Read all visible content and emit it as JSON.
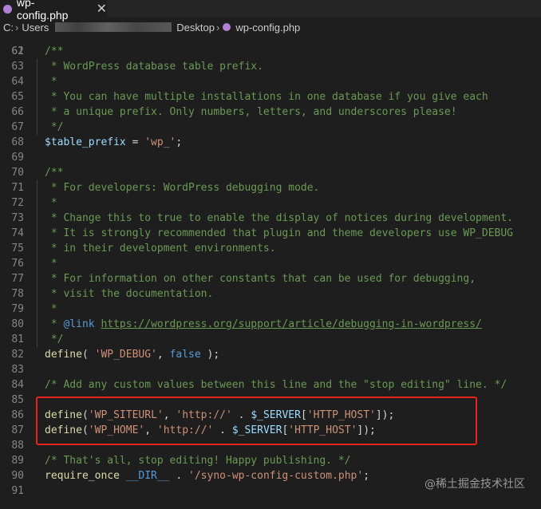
{
  "tab": {
    "filename": "wp-config.php",
    "close_glyph": "✕",
    "icon": "php-elephant-icon"
  },
  "breadcrumb": {
    "drive": "C:",
    "users": "Users",
    "desktop": "Desktop",
    "file": "wp-config.php",
    "sep": "›"
  },
  "editor": {
    "partial_top_line": "61",
    "lines": [
      {
        "n": "62",
        "tokens": [
          [
            "c",
            "/**"
          ]
        ]
      },
      {
        "n": "63",
        "tokens": [
          [
            "c",
            " * WordPress database table prefix."
          ]
        ]
      },
      {
        "n": "64",
        "tokens": [
          [
            "c",
            " *"
          ]
        ]
      },
      {
        "n": "65",
        "tokens": [
          [
            "c",
            " * You can have multiple installations in one database if you give each"
          ]
        ]
      },
      {
        "n": "66",
        "tokens": [
          [
            "c",
            " * a unique prefix. Only numbers, letters, and underscores please!"
          ]
        ]
      },
      {
        "n": "67",
        "tokens": [
          [
            "c",
            " */"
          ]
        ]
      },
      {
        "n": "68",
        "tokens": [
          [
            "v",
            "$table_prefix"
          ],
          [
            "p",
            " = "
          ],
          [
            "s",
            "'wp_'"
          ],
          [
            "p",
            ";"
          ]
        ]
      },
      {
        "n": "69",
        "tokens": []
      },
      {
        "n": "70",
        "tokens": [
          [
            "c",
            "/**"
          ]
        ]
      },
      {
        "n": "71",
        "tokens": [
          [
            "c",
            " * For developers: WordPress debugging mode."
          ]
        ]
      },
      {
        "n": "72",
        "tokens": [
          [
            "c",
            " *"
          ]
        ]
      },
      {
        "n": "73",
        "tokens": [
          [
            "c",
            " * Change this to true to enable the display of notices during development."
          ]
        ]
      },
      {
        "n": "74",
        "tokens": [
          [
            "c",
            " * It is strongly recommended that plugin and theme developers use WP_DEBUG"
          ]
        ]
      },
      {
        "n": "75",
        "tokens": [
          [
            "c",
            " * in their development environments."
          ]
        ]
      },
      {
        "n": "76",
        "tokens": [
          [
            "c",
            " *"
          ]
        ]
      },
      {
        "n": "77",
        "tokens": [
          [
            "c",
            " * For information on other constants that can be used for debugging,"
          ]
        ]
      },
      {
        "n": "78",
        "tokens": [
          [
            "c",
            " * visit the documentation."
          ]
        ]
      },
      {
        "n": "79",
        "tokens": [
          [
            "c",
            " *"
          ]
        ]
      },
      {
        "n": "80",
        "tokens": [
          [
            "c",
            " * "
          ],
          [
            "d",
            "@link"
          ],
          [
            "c",
            " "
          ],
          [
            "l",
            "https://wordpress.org/support/article/debugging-in-wordpress/"
          ]
        ]
      },
      {
        "n": "81",
        "tokens": [
          [
            "c",
            " */"
          ]
        ]
      },
      {
        "n": "82",
        "tokens": [
          [
            "f",
            "define"
          ],
          [
            "p",
            "( "
          ],
          [
            "s",
            "'WP_DEBUG'"
          ],
          [
            "p",
            ", "
          ],
          [
            "k",
            "false"
          ],
          [
            "p",
            " );"
          ]
        ]
      },
      {
        "n": "83",
        "tokens": []
      },
      {
        "n": "84",
        "tokens": [
          [
            "c",
            "/* Add any custom values between this line and the \"stop editing\" line. */"
          ]
        ]
      },
      {
        "n": "85",
        "tokens": []
      },
      {
        "n": "86",
        "tokens": [
          [
            "f",
            "define"
          ],
          [
            "p",
            "("
          ],
          [
            "s",
            "'WP_SITEURL'"
          ],
          [
            "p",
            ", "
          ],
          [
            "s",
            "'http://'"
          ],
          [
            "p",
            " . "
          ],
          [
            "v",
            "$_SERVER"
          ],
          [
            "p",
            "["
          ],
          [
            "s",
            "'HTTP_HOST'"
          ],
          [
            "p",
            "]);"
          ]
        ]
      },
      {
        "n": "87",
        "tokens": [
          [
            "f",
            "define"
          ],
          [
            "p",
            "("
          ],
          [
            "s",
            "'WP_HOME'"
          ],
          [
            "p",
            ", "
          ],
          [
            "s",
            "'http://'"
          ],
          [
            "p",
            " . "
          ],
          [
            "v",
            "$_SERVER"
          ],
          [
            "p",
            "["
          ],
          [
            "s",
            "'HTTP_HOST'"
          ],
          [
            "p",
            "]);"
          ]
        ]
      },
      {
        "n": "88",
        "tokens": []
      },
      {
        "n": "89",
        "tokens": [
          [
            "c",
            "/* That's all, stop editing! Happy publishing. */"
          ]
        ]
      },
      {
        "n": "90",
        "tokens": [
          [
            "f",
            "require_once"
          ],
          [
            "p",
            " "
          ],
          [
            "k",
            "__DIR__"
          ],
          [
            "p",
            " . "
          ],
          [
            "s",
            "'/syno-wp-config-custom.php'"
          ],
          [
            "p",
            ";"
          ]
        ]
      },
      {
        "n": "91",
        "tokens": []
      }
    ]
  },
  "watermark": "@稀土掘金技术社区",
  "colors": {
    "background": "#1e1e1e",
    "comment": "#6a9955",
    "string": "#ce9178",
    "keyword": "#569cd6",
    "variable": "#9cdcfe",
    "function": "#dcdcaa",
    "highlight_border": "#e8231b"
  }
}
